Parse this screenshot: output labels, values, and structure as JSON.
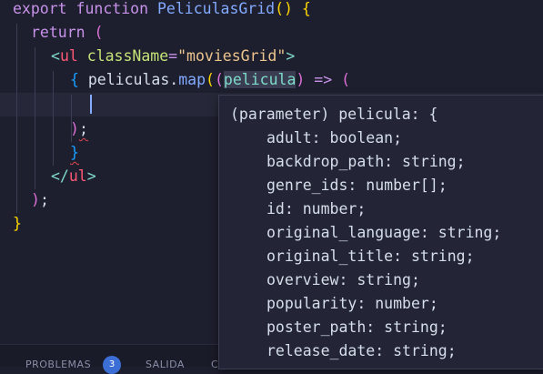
{
  "code": {
    "line1": {
      "keyword_export": "export",
      "keyword_function": "function",
      "function_name": "PeliculasGrid",
      "parens": "()",
      "brace": "{"
    },
    "line2": {
      "keyword_return": "return",
      "paren": "("
    },
    "line3": {
      "open_angle": "<",
      "tag": "ul",
      "attr": "className",
      "equals": "=",
      "value": "\"moviesGrid\"",
      "close_angle": ">"
    },
    "line4": {
      "brace_open": "{",
      "object": "peliculas",
      "dot": ".",
      "method": "map",
      "paren1": "(",
      "paren2": "(",
      "param": "pelicula",
      "paren3": ")",
      "arrow": "=>",
      "paren4": "("
    },
    "line6": {
      "paren": ")",
      "semicolon": ";"
    },
    "line7": {
      "brace_close": "}"
    },
    "line8": {
      "open": "</",
      "tag": "ul",
      "close": ">"
    },
    "line9": {
      "paren": ")",
      "semicolon": ";"
    },
    "line10": {
      "brace": "}"
    }
  },
  "hover": {
    "header": "(parameter) pelicula: {",
    "fields": [
      {
        "key": "adult",
        "type": "boolean"
      },
      {
        "key": "backdrop_path",
        "type": "string"
      },
      {
        "key": "genre_ids",
        "type": "number[]"
      },
      {
        "key": "id",
        "type": "number"
      },
      {
        "key": "original_language",
        "type": "string"
      },
      {
        "key": "original_title",
        "type": "string"
      },
      {
        "key": "overview",
        "type": "string"
      },
      {
        "key": "popularity",
        "type": "number"
      },
      {
        "key": "poster_path",
        "type": "string"
      },
      {
        "key": "release_date",
        "type": "string"
      }
    ]
  },
  "panel": {
    "tab_problems": "PROBLEMAS",
    "problems_count": "3",
    "tab_output": "SALIDA",
    "tab_next_partial": "C"
  }
}
